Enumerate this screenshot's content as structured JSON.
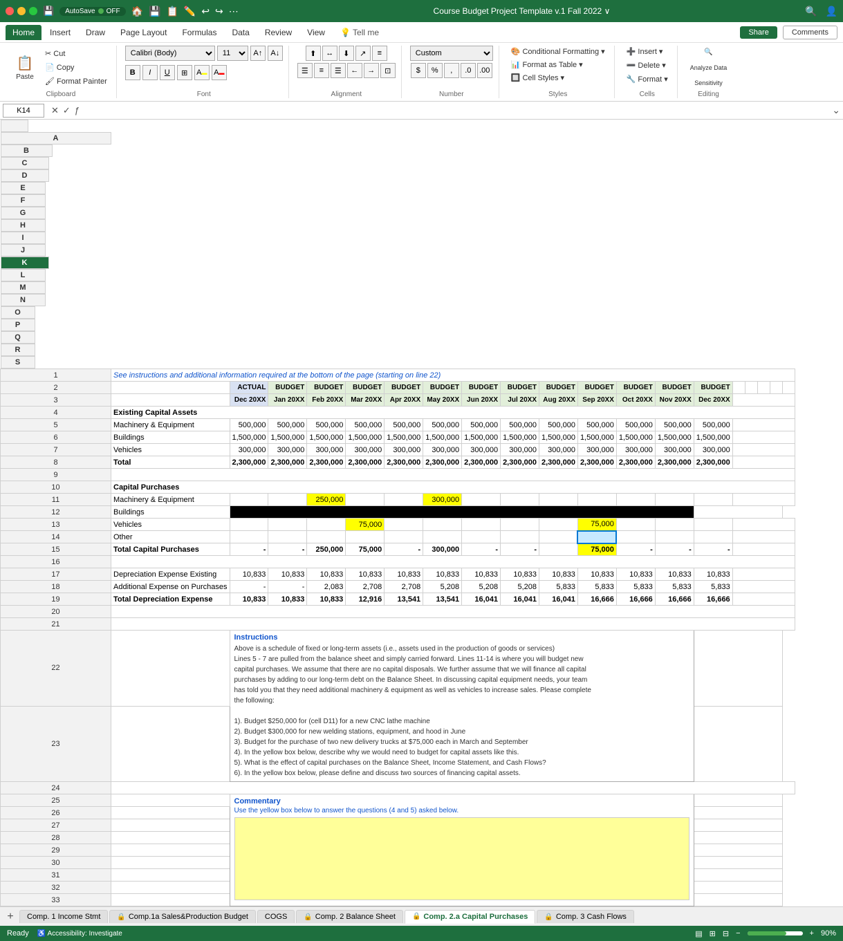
{
  "titleBar": {
    "title": "Course Budget Project Template v.1 Fall 2022",
    "autosave": "AutoSave",
    "autosaveState": "OFF"
  },
  "menuBar": {
    "items": [
      "Home",
      "Insert",
      "Draw",
      "Page Layout",
      "Formulas",
      "Data",
      "Review",
      "View",
      "Tell me"
    ],
    "active": "Home"
  },
  "ribbon": {
    "clipboard": {
      "label": "Clipboard",
      "paste": "Paste"
    },
    "font": {
      "label": "Font",
      "family": "Calibri (Body)",
      "size": "11",
      "bold": "B",
      "italic": "I",
      "underline": "U"
    },
    "alignment": {
      "label": "Alignment"
    },
    "number": {
      "label": "Number",
      "format": "Custom"
    },
    "styles": {
      "label": "Styles",
      "conditionalFormatting": "Conditional Formatting",
      "formatAsTable": "Format as Table",
      "cellStyles": "Cell Styles"
    },
    "cells": {
      "label": "Cells",
      "insert": "Insert",
      "delete": "Delete",
      "format": "Format"
    },
    "editing": {
      "label": "Editing"
    },
    "share": "Share",
    "comments": "Comments"
  },
  "formulaBar": {
    "cellRef": "K14",
    "formula": ""
  },
  "columns": [
    "A",
    "B",
    "C",
    "D",
    "E",
    "F",
    "G",
    "H",
    "I",
    "J",
    "K",
    "L",
    "M",
    "N",
    "O",
    "P",
    "Q",
    "R",
    "S"
  ],
  "rows": {
    "1": {
      "a": "See instructions and additional information required at the bottom of the page (starting on line 22)"
    },
    "2": {
      "b": "ACTUAL",
      "c": "BUDGET",
      "d": "BUDGET",
      "e": "BUDGET",
      "f": "BUDGET",
      "g": "BUDGET",
      "h": "BUDGET",
      "i": "BUDGET",
      "j": "BUDGET",
      "k": "BUDGET",
      "l": "BUDGET",
      "m": "BUDGET",
      "n": "BUDGET"
    },
    "3": {
      "b": "Dec 20XX",
      "c": "Jan 20XX",
      "d": "Feb 20XX",
      "e": "Mar 20XX",
      "f": "Apr 20XX",
      "g": "May 20XX",
      "h": "Jun 20XX",
      "i": "Jul 20XX",
      "j": "Aug 20XX",
      "k": "Sep 20XX",
      "l": "Oct 20XX",
      "m": "Nov 20XX",
      "n": "Dec 20XX"
    },
    "4": {
      "a": "Existing Capital Assets"
    },
    "5": {
      "a": "Machinery & Equipment",
      "b": "500,000",
      "c": "500,000",
      "d": "500,000",
      "e": "500,000",
      "f": "500,000",
      "g": "500,000",
      "h": "500,000",
      "i": "500,000",
      "j": "500,000",
      "k": "500,000",
      "l": "500,000",
      "m": "500,000",
      "n": "500,000"
    },
    "6": {
      "a": "Buildings",
      "b": "1,500,000",
      "c": "1,500,000",
      "d": "1,500,000",
      "e": "1,500,000",
      "f": "1,500,000",
      "g": "1,500,000",
      "h": "1,500,000",
      "i": "1,500,000",
      "j": "1,500,000",
      "k": "1,500,000",
      "l": "1,500,000",
      "m": "1,500,000",
      "n": "1,500,000"
    },
    "7": {
      "a": "Vehicles",
      "b": "300,000",
      "c": "300,000",
      "d": "300,000",
      "e": "300,000",
      "f": "300,000",
      "g": "300,000",
      "h": "300,000",
      "i": "300,000",
      "j": "300,000",
      "k": "300,000",
      "l": "300,000",
      "m": "300,000",
      "n": "300,000"
    },
    "8": {
      "a": "Total",
      "b": "2,300,000",
      "c": "2,300,000",
      "d": "2,300,000",
      "e": "2,300,000",
      "f": "2,300,000",
      "g": "2,300,000",
      "h": "2,300,000",
      "i": "2,300,000",
      "j": "2,300,000",
      "k": "2,300,000",
      "l": "2,300,000",
      "m": "2,300,000",
      "n": "2,300,000"
    },
    "10": {
      "a": "Capital Purchases"
    },
    "11": {
      "a": "Machinery & Equipment",
      "d": "250,000",
      "g": "300,000"
    },
    "12": {
      "a": "Buildings"
    },
    "13": {
      "a": "Vehicles",
      "e": "75,000",
      "k": "75,000"
    },
    "14": {
      "a": "Other"
    },
    "15": {
      "a": "Total Capital Purchases",
      "b": "-",
      "c": "-",
      "d": "250,000",
      "e": "75,000",
      "f": "-",
      "g": "300,000",
      "h": "-",
      "i": "-",
      "k": "75,000",
      "l": "-",
      "m": "-",
      "n": "-"
    },
    "17": {
      "a": "Depreciation Expense Existing",
      "b": "10,833",
      "c": "10,833",
      "d": "10,833",
      "e": "10,833",
      "f": "10,833",
      "g": "10,833",
      "h": "10,833",
      "i": "10,833",
      "j": "10,833",
      "k": "10,833",
      "l": "10,833",
      "m": "10,833",
      "n": "10,833"
    },
    "18": {
      "a": "Additional Expense on Purchases",
      "b": "-",
      "c": "-",
      "d": "2,083",
      "e": "2,708",
      "f": "2,708",
      "g": "5,208",
      "h": "5,208",
      "i": "5,208",
      "j": "5,833",
      "k": "5,833",
      "l": "5,833",
      "m": "5,833",
      "n": "5,833"
    },
    "19": {
      "a": "Total Depreciation Expense",
      "b": "10,833",
      "c": "10,833",
      "d": "10,833",
      "e": "12,916",
      "f": "13,541",
      "g": "13,541",
      "h": "16,041",
      "i": "16,041",
      "j": "16,041",
      "k": "16,666",
      "l": "16,666",
      "m": "16,666",
      "n": "16,666"
    },
    "22": {
      "header": "Instructions",
      "content": "Above is a schedule of fixed or long-term assets (i.e., assets used in the production of goods or services)\nLines 5 - 7 are pulled from the balance sheet and simply carried forward. Lines 11-14 is where you will budget new\ncapital purchases. We assume that there are no capital disposals. We further assume that we will finance all capital\npurchases by adding to our long-term debt on the Balance Sheet. In discussing capital equipment needs, your team\nhas told you that they need additional machinery & equipment as well as vehicles to increase sales. Please complete\nthe following:\n\n1). Budget $250,000 for (cell D11) for a new CNC lathe machine\n2). Budget $300,000 for new welding stations, equipment, and hood in June\n3). Budget for the purchase of two new delivery trucks at $75,000 each in March and September\n4). In the yellow box below, describe why we would need to budget for capital assets like this.\n5). What is the effect of capital purchases on the Balance Sheet, Income Statement, and Cash Flows?\n6). In the yellow box below, please define and discuss two sources of financing capital assets."
    },
    "25": {
      "commentary_header": "Commentary",
      "commentary_sub": "Use the yellow box below to answer the questions (4 and 5) asked below."
    }
  },
  "sheetTabs": [
    {
      "label": "Comp. 1 Income Stmt",
      "locked": false,
      "active": false
    },
    {
      "label": "Comp.1a Sales&Production Budget",
      "locked": true,
      "active": false
    },
    {
      "label": "COGS",
      "locked": false,
      "active": false
    },
    {
      "label": "Comp. 2 Balance Sheet",
      "locked": true,
      "active": false
    },
    {
      "label": "Comp. 2.a Capital Purchases",
      "locked": true,
      "active": true
    },
    {
      "label": "Comp. 3 Cash Flows",
      "locked": true,
      "active": false
    }
  ],
  "statusBar": {
    "left": "Ready",
    "accessibility": "Accessibility: Investigate",
    "zoom": "90%"
  }
}
